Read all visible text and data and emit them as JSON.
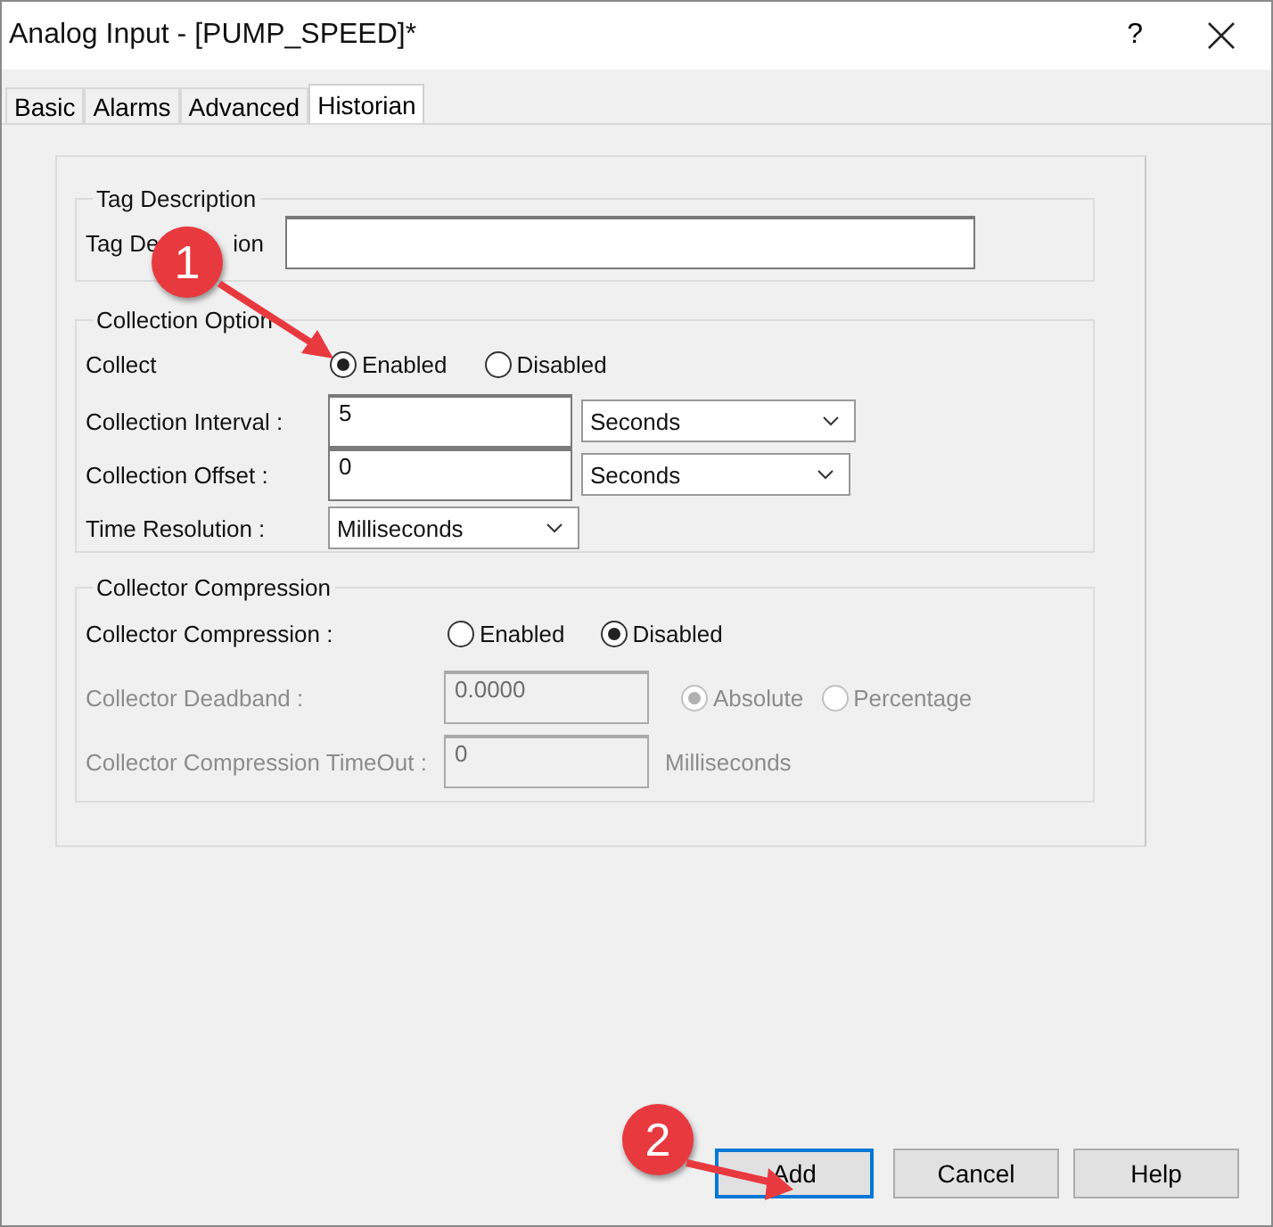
{
  "window": {
    "title": "Analog Input - [PUMP_SPEED]*",
    "help": "?"
  },
  "tabs": [
    {
      "label": "Basic",
      "selected": false
    },
    {
      "label": "Alarms",
      "selected": false
    },
    {
      "label": "Advanced",
      "selected": false
    },
    {
      "label": "Historian",
      "selected": true
    }
  ],
  "tag_description": {
    "legend": "Tag Description",
    "label_start": "Tag De",
    "label_end": "ion"
  },
  "collection_options": {
    "legend": "Collection Option",
    "collect": {
      "label": "Collect",
      "options": [
        {
          "label": "Enabled",
          "selected": true
        },
        {
          "label": "Disabled",
          "selected": false
        }
      ]
    },
    "interval": {
      "label": "Collection Interval :",
      "value": "5",
      "unit": "Seconds"
    },
    "offset": {
      "label": "Collection Offset :",
      "value": "0",
      "unit": "Seconds"
    },
    "resolution": {
      "label": "Time Resolution :",
      "value": "Milliseconds"
    }
  },
  "collector_compression": {
    "legend": "Collector Compression",
    "rows": [
      {
        "kind": "radio",
        "label": "Collector Compression :",
        "disabled": false,
        "options": [
          {
            "label": "Enabled",
            "selected": false
          },
          {
            "label": "Disabled",
            "selected": true
          }
        ]
      },
      {
        "kind": "field-radio",
        "label": "Collector Deadband :",
        "disabled": true,
        "value": "0.0000",
        "options": [
          {
            "label": "Absolute",
            "selected": true
          },
          {
            "label": "Percentage",
            "selected": false
          }
        ]
      },
      {
        "kind": "field-unit",
        "label": "Collector Compression TimeOut :",
        "disabled": true,
        "value": "0",
        "unit": "Milliseconds"
      }
    ]
  },
  "buttons": [
    {
      "label": "Add",
      "focused": true
    },
    {
      "label": "Cancel",
      "focused": false
    },
    {
      "label": "Help",
      "focused": false
    }
  ],
  "annotations": [
    {
      "number": "1"
    },
    {
      "number": "2"
    }
  ]
}
